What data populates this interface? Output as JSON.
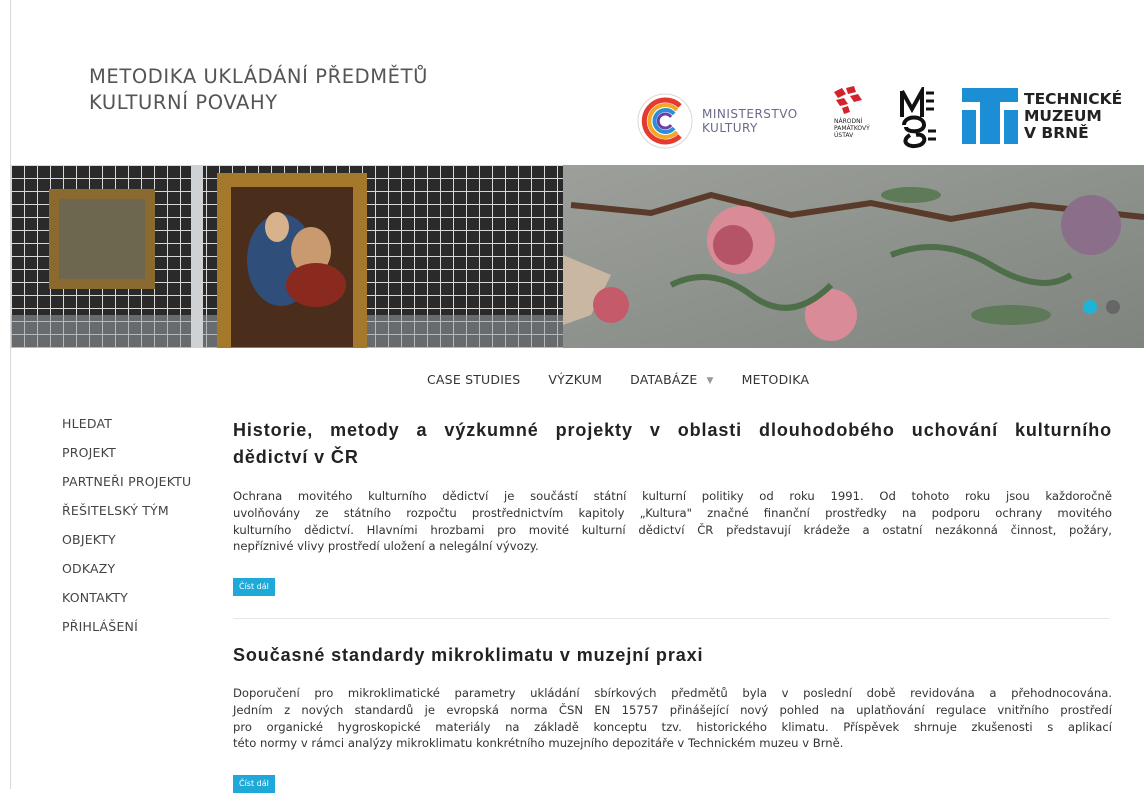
{
  "site": {
    "title_line1": "METODIKA UKLÁDÁNÍ PŘEDMĚTŮ",
    "title_line2": "KULTURNÍ POVAHY"
  },
  "logos": {
    "mk_line1": "MINISTERSTVO",
    "mk_line2": "KULTURY",
    "npu_text": [
      "NÁRODNÍ",
      "PAMÁTKOVÝ",
      "ÚSTAV"
    ],
    "tm_line1": "TECHNICKÉ",
    "tm_line2": "MUZEUM",
    "tm_line3": "V BRNĚ"
  },
  "colors": {
    "accent": "#1fa9d9",
    "slider_active": "#1fb4d6",
    "tm_blue": "#1b8ed6"
  },
  "top_nav": [
    {
      "label": "CASE STUDIES"
    },
    {
      "label": "VÝZKUM"
    },
    {
      "label": "DATABÁZE",
      "has_dropdown": true
    },
    {
      "label": "METODIKA"
    }
  ],
  "side_nav": [
    "HLEDAT",
    "PROJEKT",
    "PARTNEŘI PROJEKTU",
    "ŘEŠITELSKÝ TÝM",
    "OBJEKTY",
    "ODKAZY",
    "KONTAKTY",
    "PŘIHLÁŠENÍ"
  ],
  "articles": [
    {
      "title_line1": "Historie, metody a výzkumné projekty v oblasti dlouhodobého uchování kulturního",
      "title_line2": "dědictví v ČR",
      "body_lines": [
        "Ochrana movitého kulturního dědictví je součástí státní kulturní politiky od roku 1991. Od tohoto roku jsou každoročně",
        "uvolňovány ze státního rozpočtu prostřednictvím kapitoly „Kultura\" značné finanční prostředky na podporu ochrany movitého",
        "kulturního dědictví. Hlavními hrozbami pro movité kulturní dědictví ČR představují krádeže a ostatní nezákonná činnost, požáry,",
        "nepříznivé vlivy prostředí uložení a nelegální vývozy."
      ],
      "button": "Číst dál"
    },
    {
      "title": "Současné standardy mikroklimatu v muzejní praxi",
      "body_lines": [
        "Doporučení pro mikroklimatické parametry ukládání sbírkových předmětů byla v poslední době revidována a přehodnocována.",
        "Jedním z nových standardů je evropská norma ČSN EN 15757 přinášející nový pohled na uplatňování regulace vnitřního prostředí",
        "pro organické hygroskopické materiály na základě konceptu tzv. historického klimatu. Příspěvek shrnuje zkušenosti s aplikací",
        "této normy v rámci analýzy mikroklimatu konkrétního muzejního depozitáře v Technickém muzeu v Brně."
      ],
      "button": "Číst dál"
    }
  ]
}
